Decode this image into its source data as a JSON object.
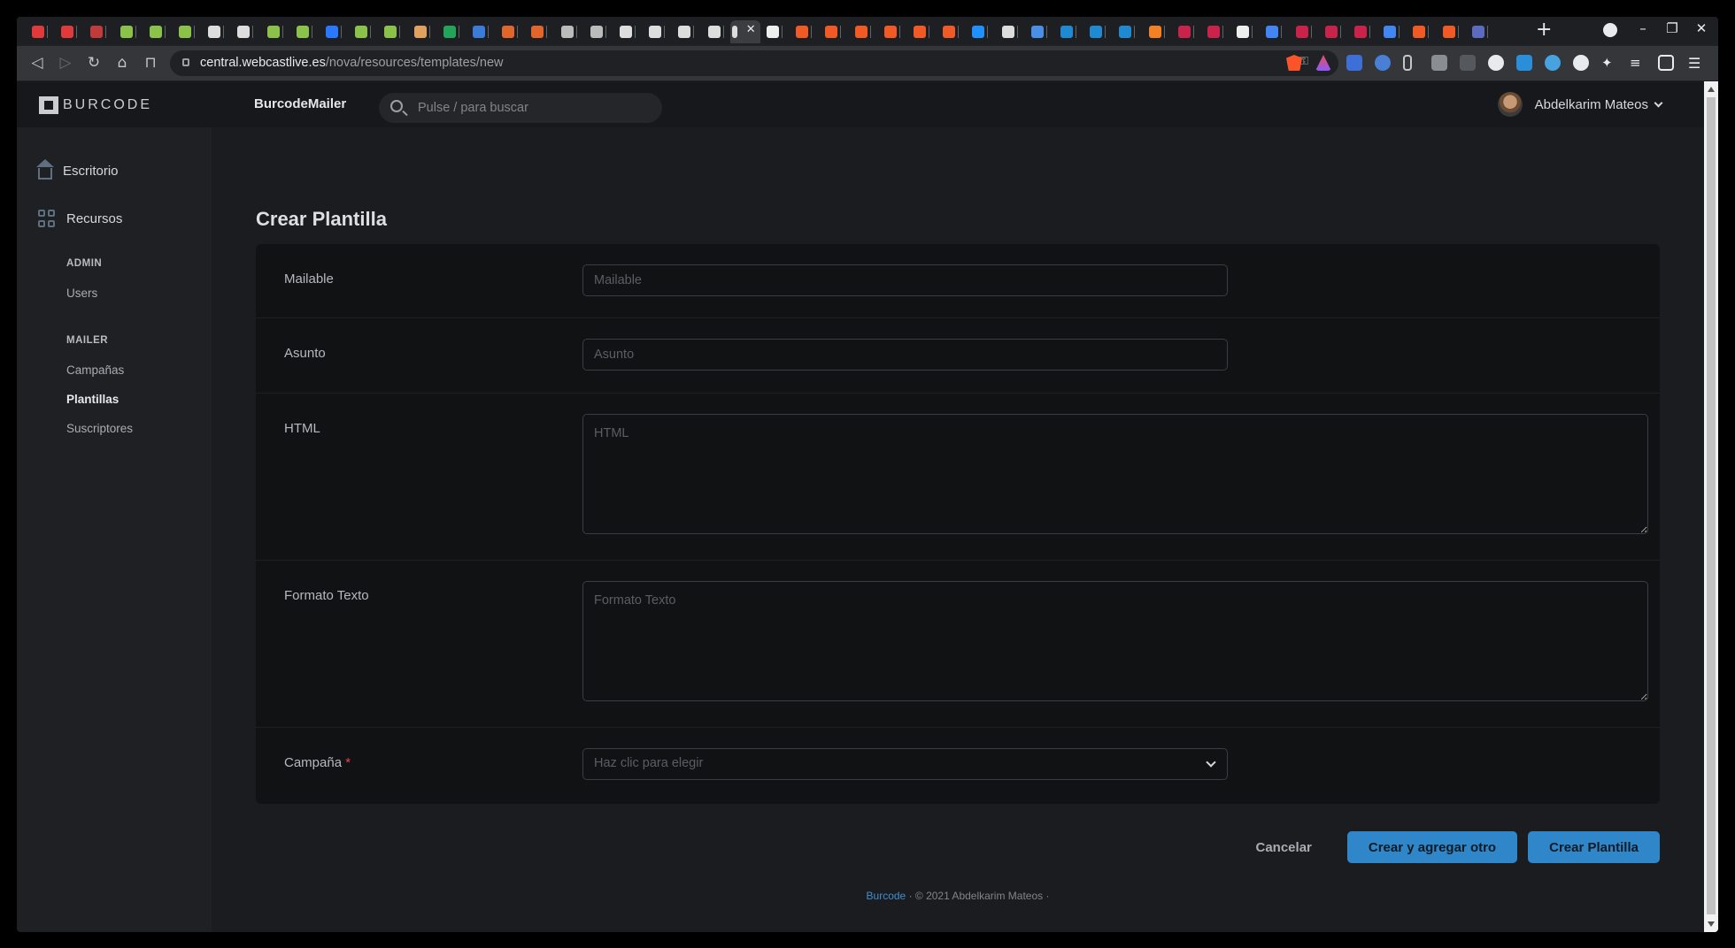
{
  "browser": {
    "url_host": "central.webcastlive.es",
    "url_path": "/nova/resources/templates/new",
    "tab_colors": [
      "#e03a3a",
      "#e03a3a",
      "#c23b3b",
      "#8bc34a",
      "#8bc34a",
      "#8bc34a",
      "#dddddd",
      "#dddddd",
      "#8bc34a",
      "#8bc34a",
      "#2979ff",
      "#8bc34a",
      "#8bc34a",
      "#e0a060",
      "#22a45a",
      "#3d7bd9",
      "#e2652b",
      "#e2652b",
      "#bbbbbb",
      "#bbbbbb",
      "#dddddd",
      "#dddddd",
      "#dddddd",
      "#dddddd",
      "#dddddd",
      "#eeeeee",
      "#f15a24",
      "#f15a24",
      "#f15a24",
      "#f15a24",
      "#f15a24",
      "#f15a24",
      "#1e90ff",
      "#dddddd",
      "#4a8fe7",
      "#1f8ad2",
      "#1f8ad2",
      "#1f8ad2",
      "#f48024",
      "#c9234c",
      "#c9234c",
      "#eeeeee",
      "#4285f4",
      "#c9234c",
      "#c9234c",
      "#c9234c",
      "#4285f4",
      "#f15a24",
      "#f15a24",
      "#5c6bc0"
    ],
    "icons": [
      "back-icon",
      "forward-icon",
      "reload-icon",
      "home-icon",
      "bookmark-icon",
      "lock-icon",
      "key-icon",
      "new-tab-icon",
      "minimize-icon",
      "maximize-icon",
      "close-icon"
    ]
  },
  "sidebar": {
    "logo": "BURCODE",
    "main": [
      {
        "label": "Escritorio",
        "icon": "home-icon"
      },
      {
        "label": "Recursos",
        "icon": "grid-icon"
      }
    ],
    "groups": [
      {
        "title": "ADMIN",
        "items": [
          "Users"
        ]
      },
      {
        "title": "MAILER",
        "items": [
          "Campañas",
          "Plantillas",
          "Suscriptores"
        ]
      }
    ],
    "active_item": "Plantillas"
  },
  "header": {
    "app_name": "BurcodeMailer",
    "search_placeholder": "Pulse / para buscar",
    "user_name": "Abdelkarim Mateos"
  },
  "form": {
    "title": "Crear Plantilla",
    "fields": [
      {
        "label": "Mailable",
        "placeholder": "Mailable",
        "value": ""
      },
      {
        "label": "Asunto",
        "placeholder": "Asunto",
        "value": ""
      },
      {
        "label": "HTML",
        "placeholder": "HTML",
        "value": ""
      },
      {
        "label": "Formato Texto",
        "placeholder": "Formato Texto",
        "value": ""
      },
      {
        "label": "Campaña",
        "required_mark": "*",
        "placeholder": "Haz clic para elegir"
      }
    ],
    "buttons": {
      "cancel": "Cancelar",
      "create_another": "Crear y agregar otro",
      "create": "Crear Plantilla"
    }
  },
  "footer": {
    "link": "Burcode",
    "text": "· © 2021 Abdelkarim Mateos ·"
  }
}
